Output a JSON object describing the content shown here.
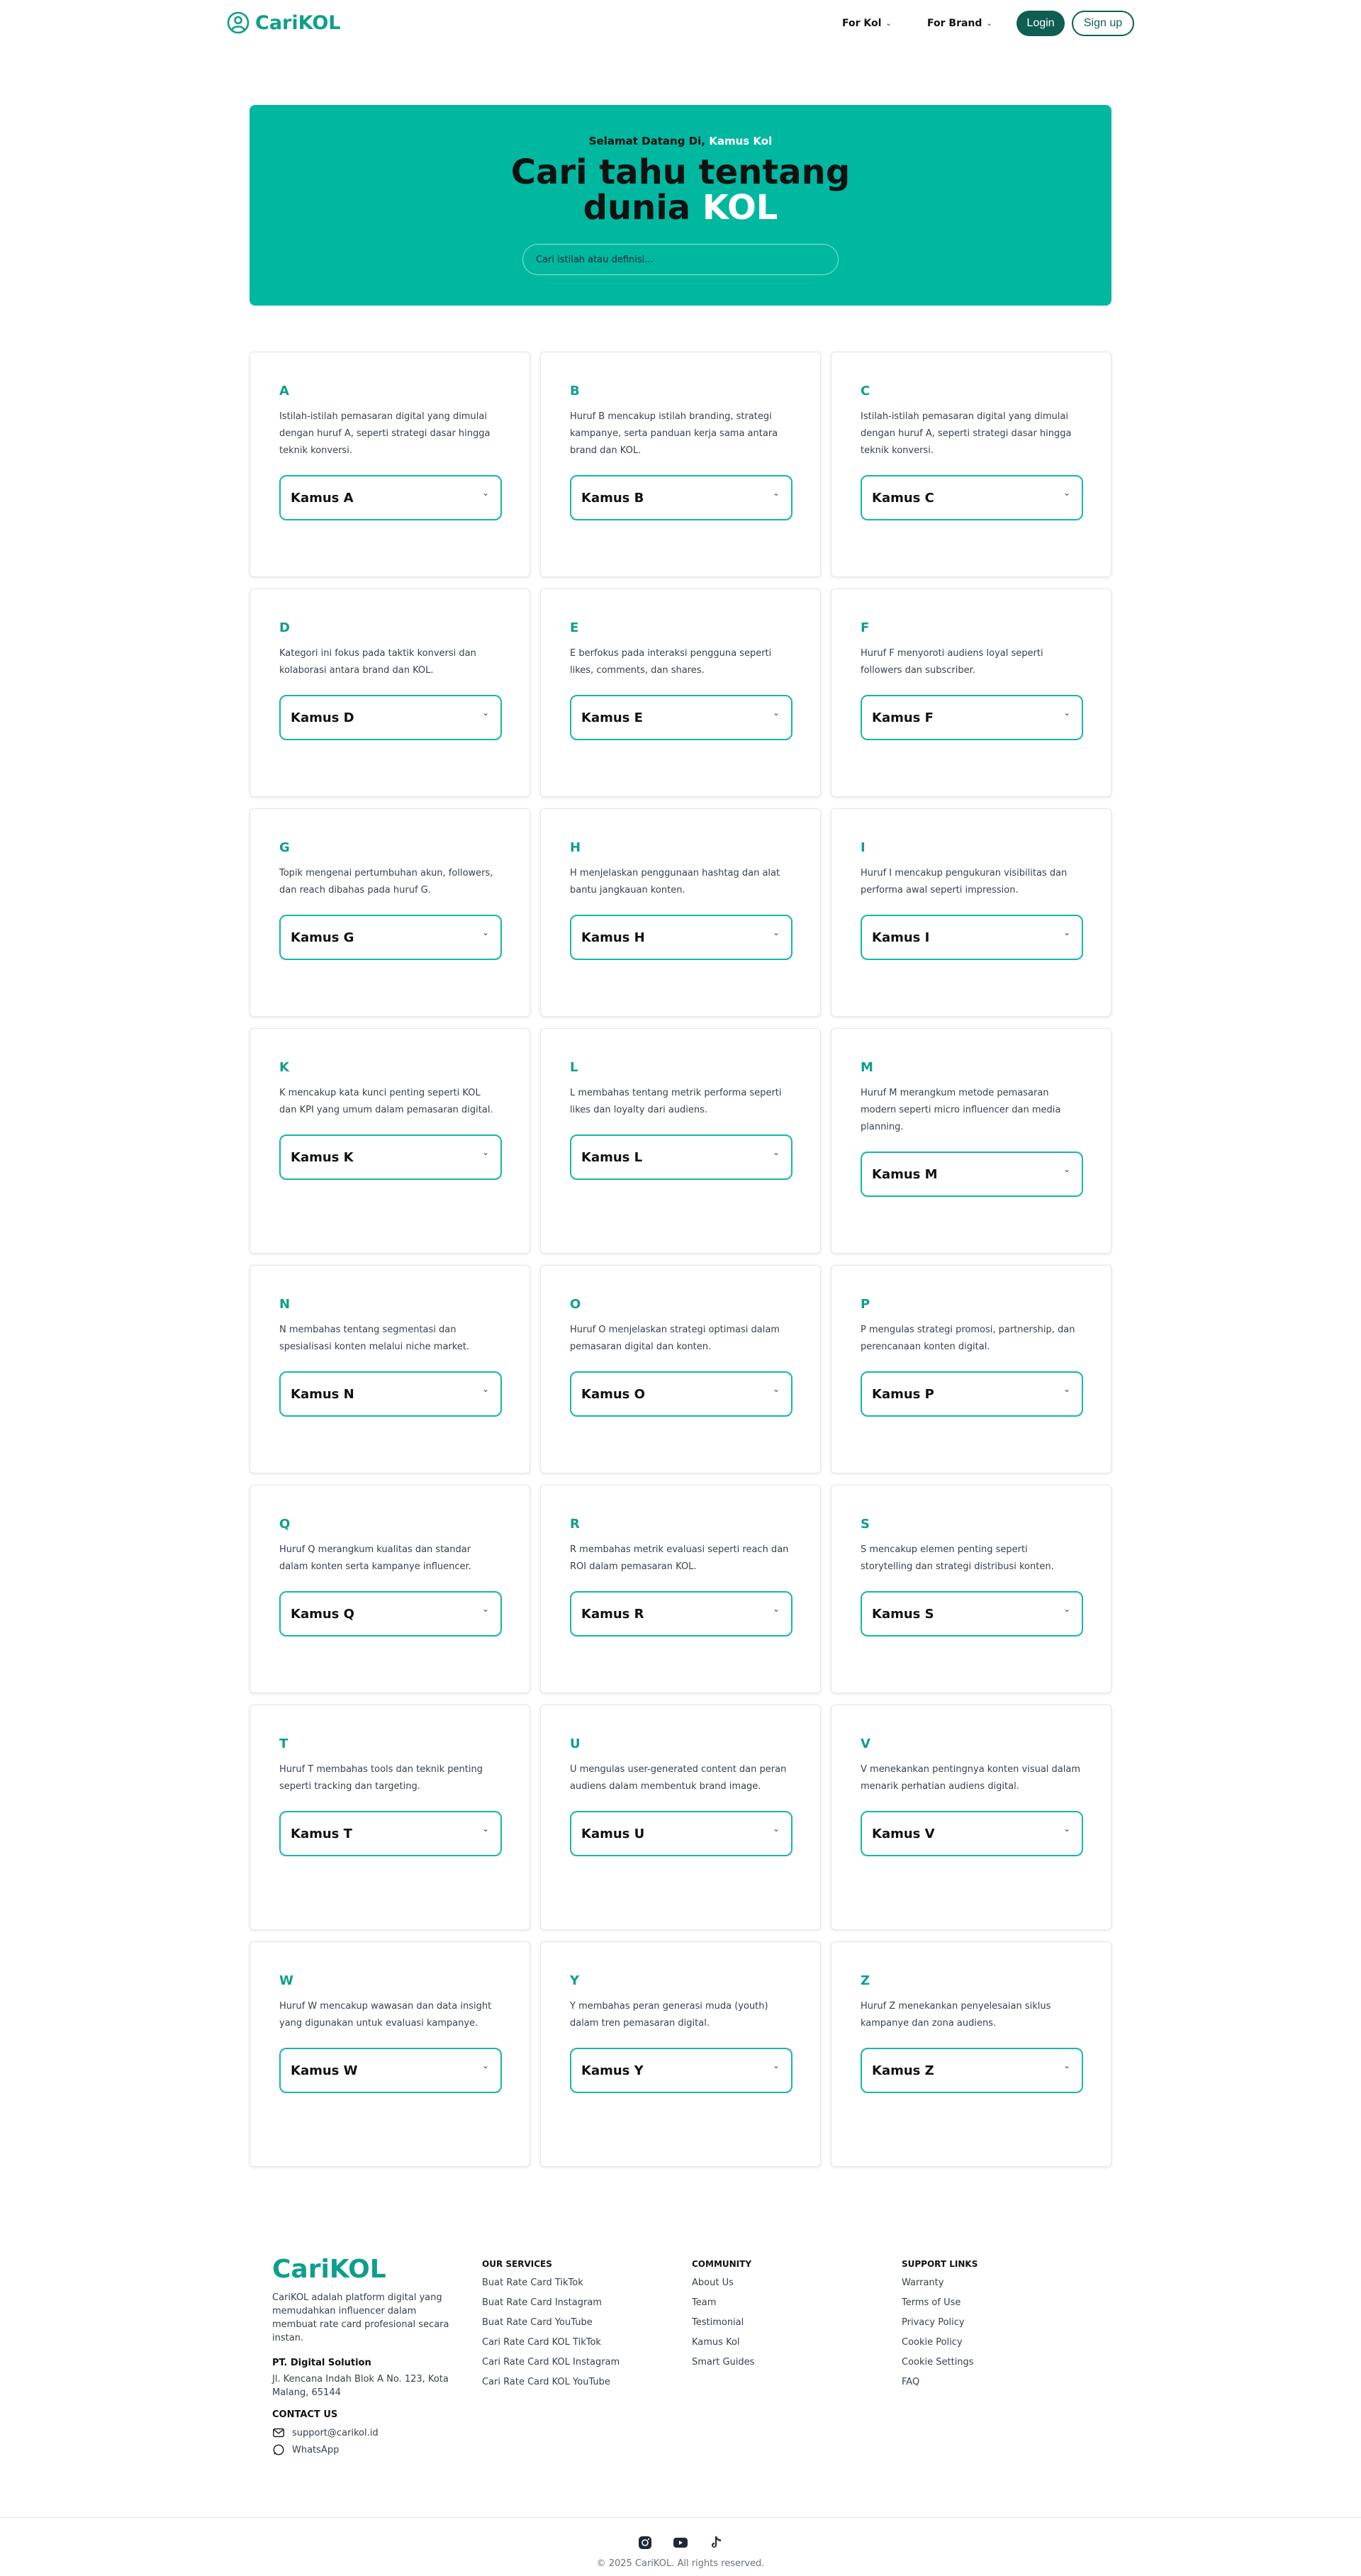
{
  "brand": {
    "name": "CariKOL",
    "accent": "#0e9f8a",
    "hero_bg": "#00b8a0",
    "dark": "#0f5e52"
  },
  "nav": {
    "for_kol": "For Kol",
    "for_brand": "For Brand",
    "login": "Login",
    "signup": "Sign up"
  },
  "hero": {
    "kicker_prefix": "Selamat Datang Di",
    "kicker_highlight": "Kamus Kol",
    "title_line1": "Cari tahu tentang",
    "title_line2_prefix": "dunia",
    "title_line2_highlight": "KOL",
    "search_placeholder": "Cari istilah atau definisi..."
  },
  "cards": [
    {
      "letter": "A",
      "desc": "Istilah-istilah pemasaran digital yang dimulai dengan huruf A, seperti strategi dasar hingga teknik konversi.",
      "select": "Kamus A"
    },
    {
      "letter": "B",
      "desc": "Huruf B mencakup istilah branding, strategi kampanye, serta panduan kerja sama antara brand dan KOL.",
      "select": "Kamus B"
    },
    {
      "letter": "C",
      "desc": "Istilah-istilah pemasaran digital yang dimulai dengan huruf A, seperti strategi dasar hingga teknik konversi.",
      "select": "Kamus C"
    },
    {
      "letter": "D",
      "desc": "Kategori ini fokus pada taktik konversi dan kolaborasi antara brand dan KOL.",
      "select": "Kamus D"
    },
    {
      "letter": "E",
      "desc": "E berfokus pada interaksi pengguna seperti likes, comments, dan shares.",
      "select": "Kamus E"
    },
    {
      "letter": "F",
      "desc": "Huruf F menyoroti audiens loyal seperti followers dan subscriber.",
      "select": "Kamus F"
    },
    {
      "letter": "G",
      "desc": "Topik mengenai pertumbuhan akun, followers, dan reach dibahas pada huruf G.",
      "select": "Kamus G"
    },
    {
      "letter": "H",
      "desc": "H menjelaskan penggunaan hashtag dan alat bantu jangkauan konten.",
      "select": "Kamus H"
    },
    {
      "letter": "I",
      "desc": "Huruf I mencakup pengukuran visibilitas dan performa awal seperti impression.",
      "select": "Kamus I"
    },
    {
      "letter": "K",
      "desc": "K mencakup kata kunci penting seperti KOL dan KPI yang umum dalam pemasaran digital.",
      "select": "Kamus K"
    },
    {
      "letter": "L",
      "desc": "L membahas tentang metrik performa seperti likes dan loyalty dari audiens.",
      "select": "Kamus L"
    },
    {
      "letter": "M",
      "desc": "Huruf M merangkum metode pemasaran modern seperti micro influencer dan media planning.",
      "select": "Kamus M"
    },
    {
      "letter": "N",
      "desc": "N membahas tentang segmentasi dan spesialisasi konten melalui niche market.",
      "select": "Kamus N"
    },
    {
      "letter": "O",
      "desc": "Huruf O menjelaskan strategi optimasi dalam pemasaran digital dan konten.",
      "select": "Kamus O"
    },
    {
      "letter": "P",
      "desc": "P mengulas strategi promosi, partnership, dan perencanaan konten digital.",
      "select": "Kamus P"
    },
    {
      "letter": "Q",
      "desc": "Huruf Q merangkum kualitas dan standar dalam konten serta kampanye influencer.",
      "select": "Kamus Q"
    },
    {
      "letter": "R",
      "desc": "R membahas metrik evaluasi seperti reach dan ROI dalam pemasaran KOL.",
      "select": "Kamus R"
    },
    {
      "letter": "S",
      "desc": "S mencakup elemen penting seperti storytelling dan strategi distribusi konten.",
      "select": "Kamus S"
    },
    {
      "letter": "T",
      "desc": "Huruf T membahas tools dan teknik penting seperti tracking dan targeting.",
      "select": "Kamus T"
    },
    {
      "letter": "U",
      "desc": "U mengulas user-generated content dan peran audiens dalam membentuk brand image.",
      "select": "Kamus U"
    },
    {
      "letter": "V",
      "desc": "V menekankan pentingnya konten visual dalam menarik perhatian audiens digital.",
      "select": "Kamus V"
    },
    {
      "letter": "W",
      "desc": "Huruf W mencakup wawasan dan data insight yang digunakan untuk evaluasi kampanye.",
      "select": "Kamus W"
    },
    {
      "letter": "Y",
      "desc": "Y membahas peran generasi muda (youth) dalam tren pemasaran digital.",
      "select": "Kamus Y"
    },
    {
      "letter": "Z",
      "desc": "Huruf Z menekankan penyelesaian siklus kampanye dan zona audiens.",
      "select": "Kamus Z"
    }
  ],
  "footer": {
    "logo": "CariKOL",
    "about": "CariKOL adalah platform digital yang memudahkan influencer dalam membuat rate card profesional secara instan.",
    "company": "PT. Digital Solution",
    "address": "Jl. Kencana Indah Blok A No. 123, Kota Malang, 65144",
    "contact_heading": "CONTACT US",
    "email": "support@carikol.id",
    "whatsapp": "WhatsApp",
    "services": {
      "heading": "OUR SERVICES",
      "links": [
        "Buat Rate Card TikTok",
        "Buat Rate Card Instagram",
        "Buat Rate Card YouTube",
        "Cari Rate Card KOL TikTok",
        "Cari Rate Card KOL Instagram",
        "Cari Rate Card KOL YouTube"
      ]
    },
    "community": {
      "heading": "COMMUNITY",
      "links": [
        "About Us",
        "Team",
        "Testimonial",
        "Kamus Kol",
        "Smart Guides"
      ]
    },
    "support": {
      "heading": "SUPPORT LINKS",
      "links": [
        "Warranty",
        "Terms of Use",
        "Privacy Policy",
        "Cookie Policy",
        "Cookie Settings",
        "FAQ"
      ]
    },
    "copyright": "© 2025 CariKOL. All rights reserved."
  }
}
